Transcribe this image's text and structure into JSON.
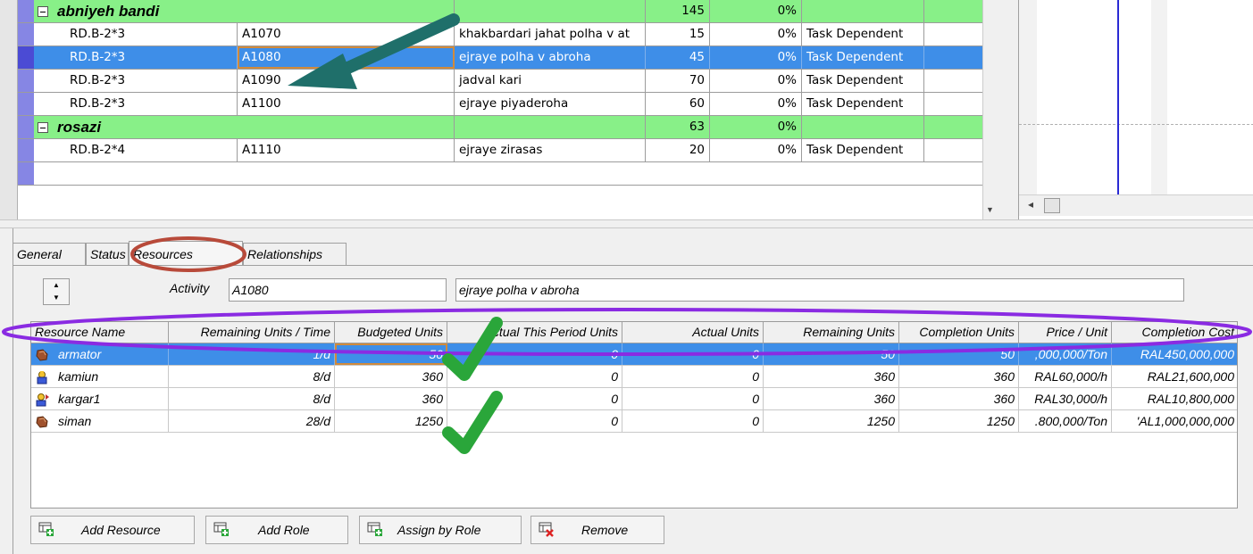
{
  "activities": {
    "groups": [
      {
        "name": "abniyeh bandi",
        "duration": "145",
        "percent": "0%",
        "rows": [
          {
            "wbs": "RD.B-2*3",
            "id": "A1070",
            "name": "khakbardari jahat polha v at",
            "duration": "15",
            "percent": "0%",
            "type": "Task Dependent",
            "selected": false
          },
          {
            "wbs": "RD.B-2*3",
            "id": "A1080",
            "name": "ejraye polha v abroha",
            "duration": "45",
            "percent": "0%",
            "type": "Task Dependent",
            "selected": true
          },
          {
            "wbs": "RD.B-2*3",
            "id": "A1090",
            "name": "jadval kari",
            "duration": "70",
            "percent": "0%",
            "type": "Task Dependent",
            "selected": false
          },
          {
            "wbs": "RD.B-2*3",
            "id": "A1100",
            "name": "ejraye piyaderoha",
            "duration": "60",
            "percent": "0%",
            "type": "Task Dependent",
            "selected": false
          }
        ]
      },
      {
        "name": "rosazi",
        "duration": "63",
        "percent": "0%",
        "rows": [
          {
            "wbs": "RD.B-2*4",
            "id": "A1110",
            "name": "ejraye zirasas",
            "duration": "20",
            "percent": "0%",
            "type": "Task Dependent",
            "selected": false
          }
        ]
      }
    ]
  },
  "tabs": [
    {
      "label": "General",
      "active": false
    },
    {
      "label": "Status",
      "active": false
    },
    {
      "label": "Resources",
      "active": true
    },
    {
      "label": "Relationships",
      "active": false
    }
  ],
  "activity_field": {
    "label": "Activity",
    "id_value": "A1080",
    "desc_value": "ejraye polha v abroha"
  },
  "resources": {
    "columns": [
      "Resource Name",
      "Remaining Units / Time",
      "Budgeted Units",
      "Actual This Period Units",
      "Actual Units",
      "Remaining Units",
      "Completion Units",
      "Price / Unit",
      "Completion Cost"
    ],
    "rows": [
      {
        "icon": "material-icon",
        "name": "armator",
        "rem_time": "1/d",
        "budgeted": "50",
        "actual_period": "0",
        "actual": "0",
        "remaining": "50",
        "completion": "50",
        "price": ",000,000/Ton",
        "cost": "RAL450,000,000",
        "selected": true
      },
      {
        "icon": "equipment-icon",
        "name": "kamiun",
        "rem_time": "8/d",
        "budgeted": "360",
        "actual_period": "0",
        "actual": "0",
        "remaining": "360",
        "completion": "360",
        "price": "RAL60,000/h",
        "cost": "RAL21,600,000",
        "selected": false
      },
      {
        "icon": "labor-icon",
        "name": "kargar1",
        "rem_time": "8/d",
        "budgeted": "360",
        "actual_period": "0",
        "actual": "0",
        "remaining": "360",
        "completion": "360",
        "price": "RAL30,000/h",
        "cost": "RAL10,800,000",
        "selected": false
      },
      {
        "icon": "material-icon",
        "name": "siman",
        "rem_time": "28/d",
        "budgeted": "1250",
        "actual_period": "0",
        "actual": "0",
        "remaining": "1250",
        "completion": "1250",
        "price": ".800,000/Ton",
        "cost": "'AL1,000,000,000",
        "selected": false
      }
    ]
  },
  "buttons": {
    "add_resource": "Add Resource",
    "add_role": "Add Role",
    "assign_by_role": "Assign by Role",
    "remove": "Remove"
  },
  "colors": {
    "group_green": "#88f088",
    "selection_blue": "#3e8ee8",
    "arrow_teal": "#1f6f6a",
    "annotation_red": "#b84a3a",
    "annotation_purple": "#8a2be2",
    "check_green": "#2aa63a"
  }
}
